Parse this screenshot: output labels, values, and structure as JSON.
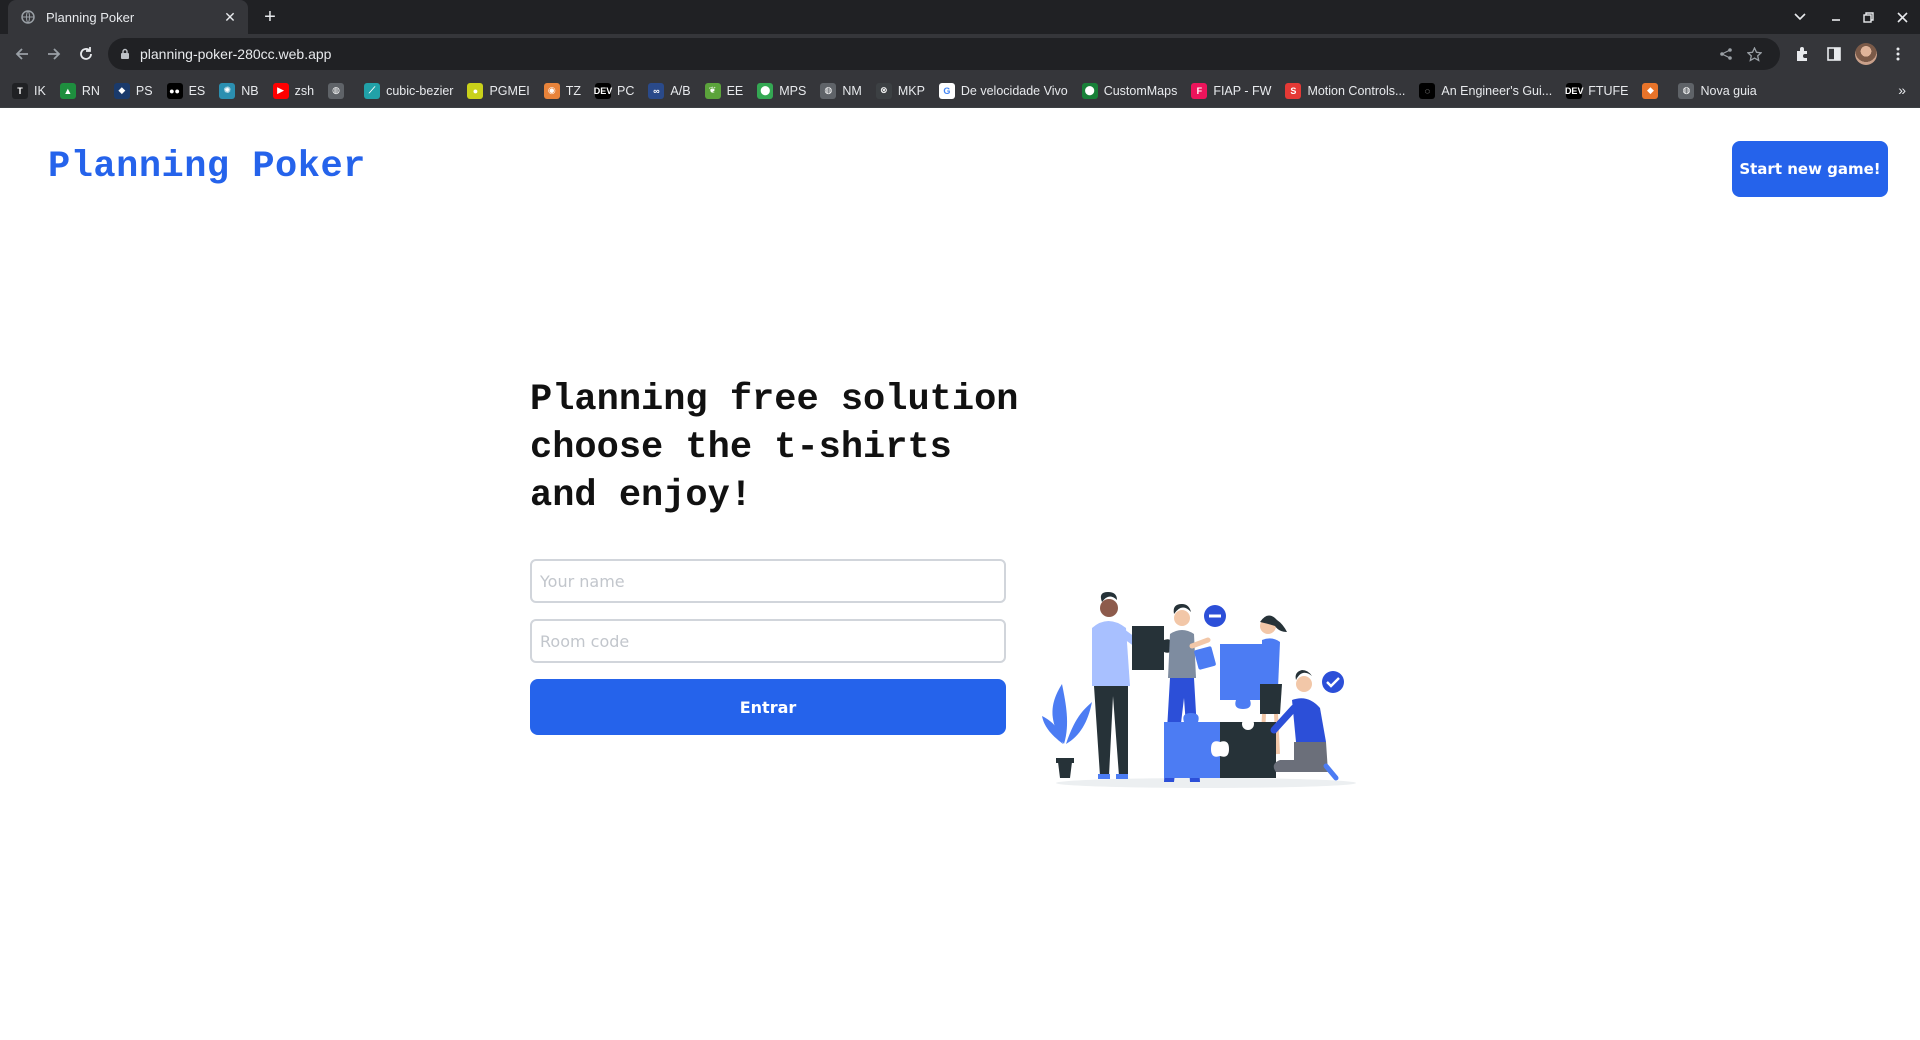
{
  "browser": {
    "tab": {
      "title": "Planning Poker"
    },
    "address": {
      "url": "planning-poker-280cc.web.app"
    },
    "bookmarks": [
      {
        "label": "IK",
        "icon": "t-icon",
        "color": "#202124",
        "glyph": "T"
      },
      {
        "label": "RN",
        "icon": "drive-icon",
        "color": "#1e8e3e",
        "glyph": "▲"
      },
      {
        "label": "PS",
        "icon": "shield-icon",
        "color": "#1a3a6b",
        "glyph": "◆"
      },
      {
        "label": "ES",
        "icon": "medium-icon",
        "color": "#000000",
        "glyph": "●●"
      },
      {
        "label": "NB",
        "icon": "atom-icon",
        "color": "#2b8fb0",
        "glyph": "✺"
      },
      {
        "label": "zsh",
        "icon": "youtube-icon",
        "color": "#ff0000",
        "glyph": "▶"
      },
      {
        "label": "",
        "icon": "globe-icon",
        "color": "#5f6368",
        "glyph": "◍"
      },
      {
        "label": "cubic-bezier",
        "icon": "curve-icon",
        "color": "#21a1a8",
        "glyph": "⟋"
      },
      {
        "label": "PGMEI",
        "icon": "coin-icon",
        "color": "#c9d11a",
        "glyph": "●"
      },
      {
        "label": "TZ",
        "icon": "fox-icon",
        "color": "#e8833a",
        "glyph": "◉"
      },
      {
        "label": "PC",
        "icon": "dev-icon",
        "color": "#000000",
        "glyph": "DEV"
      },
      {
        "label": "A/B",
        "icon": "infinity-icon",
        "color": "#2a4a8a",
        "glyph": "∞"
      },
      {
        "label": "EE",
        "icon": "leaf-icon",
        "color": "#5ba33b",
        "glyph": "❦"
      },
      {
        "label": "MPS",
        "icon": "maps-icon",
        "color": "#34a853",
        "glyph": "⬤"
      },
      {
        "label": "NM",
        "icon": "globe-icon",
        "color": "#5f6368",
        "glyph": "◍"
      },
      {
        "label": "MKP",
        "icon": "x-circle-icon",
        "color": "#3c4043",
        "glyph": "⊗"
      },
      {
        "label": "De velocidade Vivo",
        "icon": "google-icon",
        "color": "#ffffff",
        "glyph": "G"
      },
      {
        "label": "CustomMaps",
        "icon": "map-pin-icon",
        "color": "#188038",
        "glyph": "⬤"
      },
      {
        "label": "FIAP - FW",
        "icon": "fiap-icon",
        "color": "#ed145b",
        "glyph": "F"
      },
      {
        "label": "Motion Controls...",
        "icon": "s-logo-icon",
        "color": "#e53935",
        "glyph": "S"
      },
      {
        "label": "An Engineer's Gui...",
        "icon": "speech-icon",
        "color": "#000000",
        "glyph": "◌"
      },
      {
        "label": "FTUFE",
        "icon": "dev-icon",
        "color": "#000000",
        "glyph": "DEV"
      },
      {
        "label": "",
        "icon": "app-icon",
        "color": "#e8742a",
        "glyph": "◆"
      },
      {
        "label": "Nova guia",
        "icon": "globe-icon",
        "color": "#5f6368",
        "glyph": "◍"
      }
    ]
  },
  "app": {
    "logo": "Planning Poker",
    "start_button": "Start new game!",
    "hero": {
      "line1": "Planning free solution",
      "line2": "choose the t-shirts",
      "line3": "and enjoy!"
    },
    "form": {
      "name_placeholder": "Your name",
      "room_placeholder": "Room code",
      "submit_label": "Entrar"
    },
    "colors": {
      "accent": "#2563eb",
      "illustration_blue": "#4c7cf3",
      "illustration_dark": "#263238"
    }
  }
}
